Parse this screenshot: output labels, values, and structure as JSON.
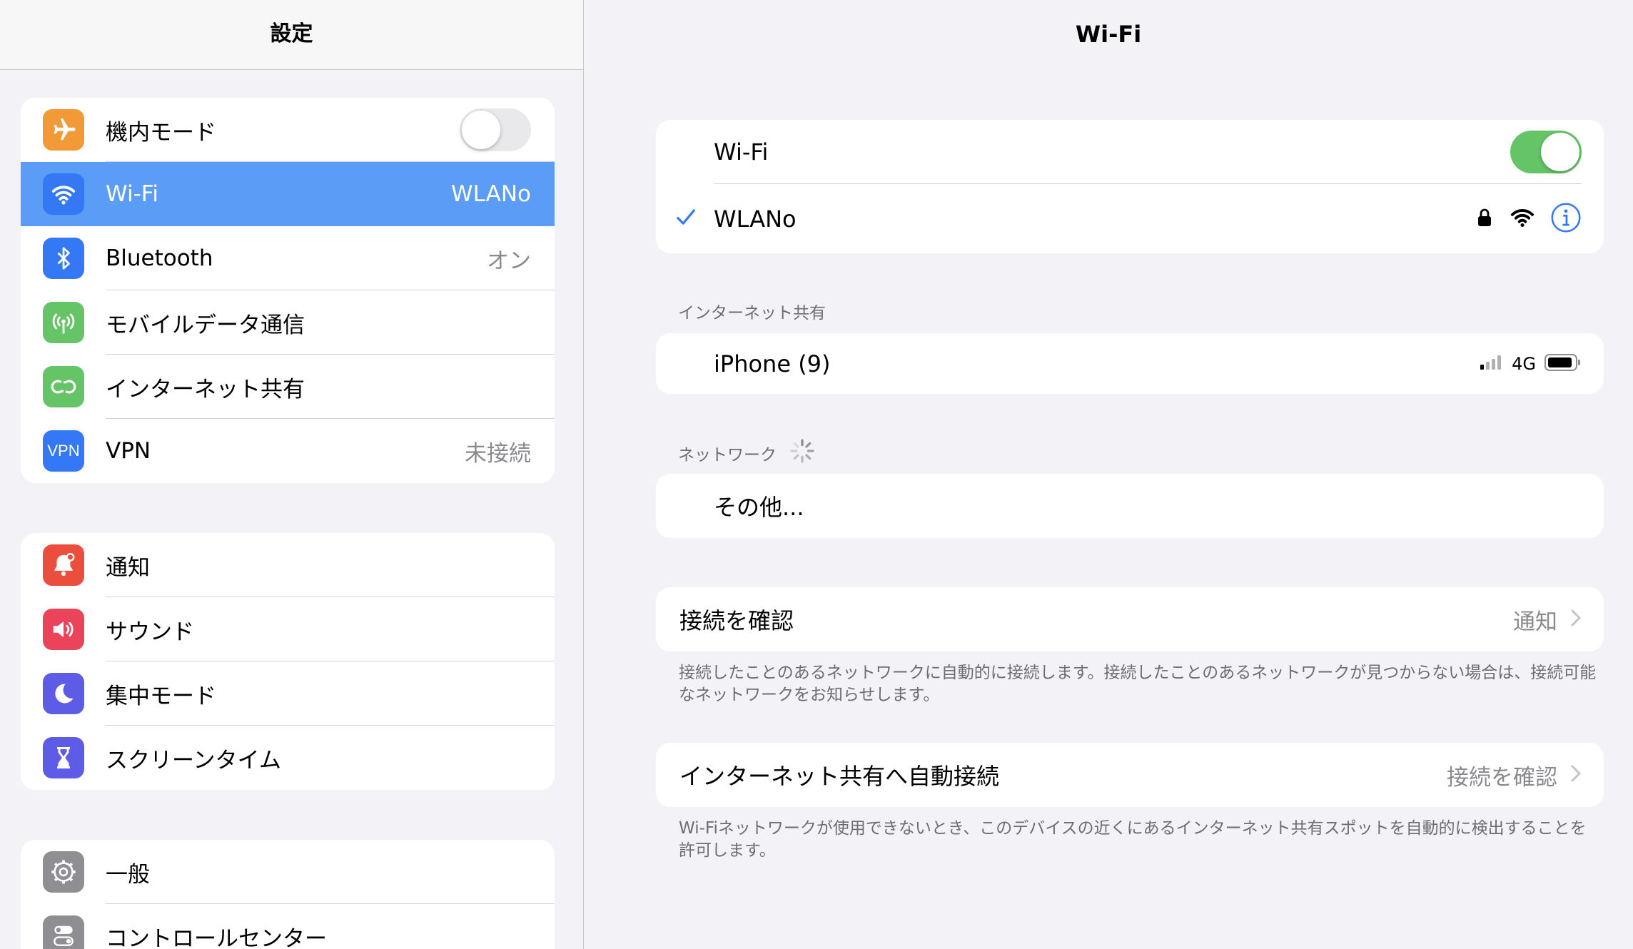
{
  "sidebar": {
    "title": "設定",
    "groups": [
      [
        {
          "label": "機内モード",
          "icon": "airplane-icon",
          "color": "#f19a37",
          "toggle": "off"
        },
        {
          "label": "Wi-Fi",
          "icon": "wifi-icon",
          "color": "#3478f6",
          "value": "WLANo",
          "selected": true
        },
        {
          "label": "Bluetooth",
          "icon": "bluetooth-icon",
          "color": "#3478f6",
          "value": "オン"
        },
        {
          "label": "モバイルデータ通信",
          "icon": "antenna-icon",
          "color": "#65c466"
        },
        {
          "label": "インターネット共有",
          "icon": "personal-hotspot-icon",
          "color": "#65c466"
        },
        {
          "label": "VPN",
          "icon": "vpn-icon",
          "color": "#3478f6",
          "value": "未接続"
        }
      ],
      [
        {
          "label": "通知",
          "icon": "notification-bell-icon",
          "color": "#eb4e3d"
        },
        {
          "label": "サウンド",
          "icon": "speaker-icon",
          "color": "#eb445a"
        },
        {
          "label": "集中モード",
          "icon": "moon-icon",
          "color": "#5e5ce6"
        },
        {
          "label": "スクリーンタイム",
          "icon": "hourglass-icon",
          "color": "#5e5ce6"
        }
      ],
      [
        {
          "label": "一般",
          "icon": "gear-icon",
          "color": "#8e8e93"
        },
        {
          "label": "コントロールセンター",
          "icon": "control-center-icon",
          "color": "#8e8e93"
        }
      ]
    ]
  },
  "detail": {
    "title": "Wi-Fi",
    "wifi_label": "Wi-Fi",
    "wifi_toggle": "on",
    "connected_network": "WLANo",
    "hotspot_header": "インターネット共有",
    "hotspot_name": "iPhone (9)",
    "hotspot_network_type": "4G",
    "networks_header": "ネットワーク",
    "other_label": "その他...",
    "ask_join_label": "接続を確認",
    "ask_join_value": "通知",
    "ask_join_footnote": "接続したことのあるネットワークに自動的に接続します。接続したことのあるネットワークが見つからない場合は、接続可能なネットワークをお知らせします。",
    "auto_hotspot_label": "インターネット共有へ自動接続",
    "auto_hotspot_value": "接続を確認",
    "auto_hotspot_footnote": "Wi-Fiネットワークが使用できないとき、このデバイスの近くにあるインターネット共有スポットを自動的に検出することを許可します。"
  },
  "colors": {
    "accent": "#3478f6",
    "selected_row": "#5b9cf7",
    "toggle_on": "#65c466"
  }
}
